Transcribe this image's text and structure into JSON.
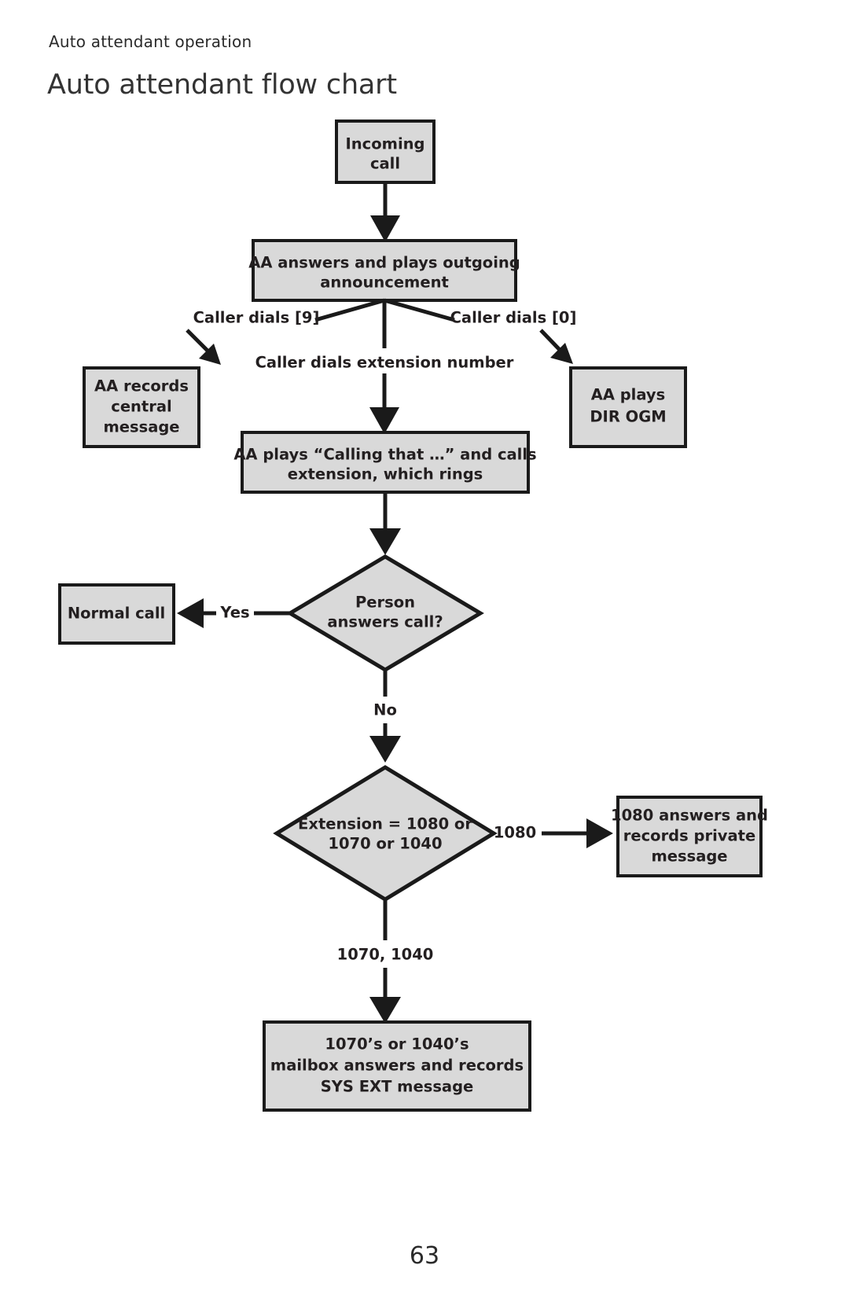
{
  "document": {
    "running_head": "Auto attendant operation",
    "title": "Auto attendant flow chart",
    "page_number": "63"
  },
  "colors": {
    "node_fill": "#d9d9d9",
    "node_border": "#1a1a1a",
    "text": "#231f20",
    "page_background": "#ffffff"
  },
  "chart_data": {
    "type": "diagram",
    "diagram_type": "flowchart",
    "title": "Auto attendant flow chart",
    "nodes": [
      {
        "id": "incoming_call",
        "shape": "rectangle",
        "lines": [
          "Incoming",
          "call"
        ]
      },
      {
        "id": "aa_answers",
        "shape": "rectangle",
        "lines": [
          "AA answers and plays outgoing",
          "announcement"
        ]
      },
      {
        "id": "aa_records",
        "shape": "rectangle",
        "lines": [
          "AA records",
          "central",
          "message"
        ]
      },
      {
        "id": "aa_plays_dir",
        "shape": "rectangle",
        "lines": [
          "AA plays",
          "DIR OGM"
        ]
      },
      {
        "id": "aa_calling",
        "shape": "rectangle",
        "lines": [
          "AA plays “Calling that …” and calls",
          "extension, which rings"
        ]
      },
      {
        "id": "person_answers",
        "shape": "diamond",
        "lines": [
          "Person",
          "answers call?"
        ]
      },
      {
        "id": "normal_call",
        "shape": "rectangle",
        "lines": [
          "Normal call"
        ]
      },
      {
        "id": "extension_check",
        "shape": "diamond",
        "lines": [
          "Extension = 1080 or",
          "1070 or 1040"
        ]
      },
      {
        "id": "private_msg",
        "shape": "rectangle",
        "lines": [
          "1080 answers and",
          "records private",
          "message"
        ]
      },
      {
        "id": "sys_ext_msg",
        "shape": "rectangle",
        "lines": [
          "1070’s or 1040’s",
          "mailbox answers and records",
          "SYS EXT message"
        ]
      }
    ],
    "edges": [
      {
        "from": "incoming_call",
        "to": "aa_answers",
        "label": ""
      },
      {
        "from": "aa_answers",
        "to": "aa_records",
        "label": "Caller dials [9]"
      },
      {
        "from": "aa_answers",
        "to": "aa_plays_dir",
        "label": "Caller dials [0]"
      },
      {
        "from": "aa_answers",
        "to": "aa_calling",
        "label": "Caller dials extension number"
      },
      {
        "from": "aa_calling",
        "to": "person_answers",
        "label": ""
      },
      {
        "from": "person_answers",
        "to": "normal_call",
        "label": "Yes"
      },
      {
        "from": "person_answers",
        "to": "extension_check",
        "label": "No"
      },
      {
        "from": "extension_check",
        "to": "private_msg",
        "label": "1080"
      },
      {
        "from": "extension_check",
        "to": "sys_ext_msg",
        "label": "1070, 1040"
      }
    ],
    "edge_labels": {
      "dials_9": "Caller dials [9]",
      "dials_0": "Caller dials [0]",
      "dials_ext": "Caller dials extension number",
      "yes": "Yes",
      "no": "No",
      "ext_1080": "1080",
      "ext_1070_1040": "1070, 1040"
    }
  },
  "nodes": {
    "incoming_call": {
      "line1": "Incoming",
      "line2": "call"
    },
    "aa_answers": {
      "line1": "AA answers and plays outgoing",
      "line2": "announcement"
    },
    "aa_records": {
      "line1": "AA records",
      "line2": "central",
      "line3": "message"
    },
    "aa_plays_dir": {
      "line1": "AA plays",
      "line2": "DIR OGM"
    },
    "aa_calling": {
      "line1": "AA plays “Calling that …” and calls",
      "line2": "extension, which rings"
    },
    "person_answers": {
      "line1": "Person",
      "line2": "answers call?"
    },
    "normal_call": {
      "line1": "Normal call"
    },
    "extension_check": {
      "line1": "Extension = 1080 or",
      "line2": "1070 or 1040"
    },
    "private_msg": {
      "line1": "1080 answers and",
      "line2": "records private",
      "line3": "message"
    },
    "sys_ext_msg": {
      "line1": "1070’s or 1040’s",
      "line2": "mailbox answers and records",
      "line3": "SYS EXT message"
    }
  }
}
